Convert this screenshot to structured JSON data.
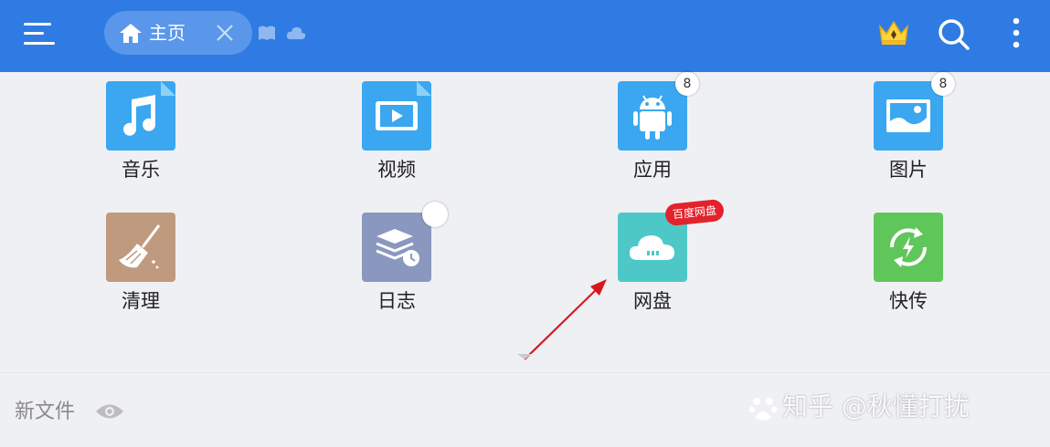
{
  "topbar": {
    "tab_label": "主页",
    "icons": [
      "menu-icon",
      "home-icon",
      "close-icon",
      "book-icon",
      "cloud-icon",
      "crown-icon",
      "search-icon",
      "more-vertical-icon"
    ]
  },
  "grid": {
    "row1": [
      {
        "label": "音乐",
        "icon": "music-icon",
        "color": "#3aa7f0"
      },
      {
        "label": "视频",
        "icon": "video-icon",
        "color": "#3aa7f0"
      },
      {
        "label": "应用",
        "icon": "android-icon",
        "color": "#3aa7f0",
        "badge": "8"
      },
      {
        "label": "图片",
        "icon": "image-icon",
        "color": "#3aa7f0",
        "badge": "8"
      }
    ],
    "row2": [
      {
        "label": "清理",
        "icon": "broom-icon",
        "color": "#c09a7e"
      },
      {
        "label": "日志",
        "icon": "log-stack-icon",
        "color": "#8a98bf"
      },
      {
        "label": "网盘",
        "icon": "netdisk-cloud-icon",
        "color": "#4dc8c7",
        "tag": "百度网盘"
      },
      {
        "label": "快传",
        "icon": "quick-transfer-icon",
        "color": "#5fc65a"
      }
    ]
  },
  "bottom": {
    "section_label": "新文件",
    "watermark": "知乎 @秋懂打扰"
  }
}
